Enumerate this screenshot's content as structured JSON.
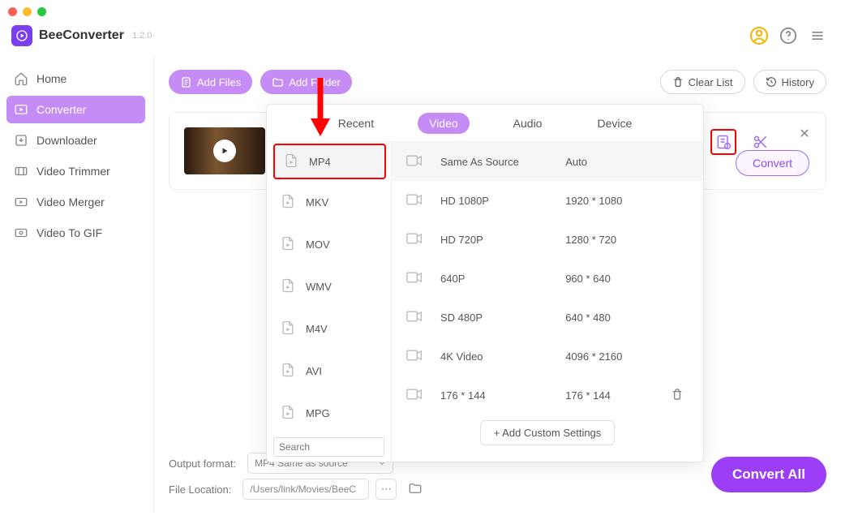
{
  "app": {
    "name": "BeeConverter",
    "version": "1.2.0"
  },
  "sidebar": {
    "items": [
      {
        "label": "Home"
      },
      {
        "label": "Converter"
      },
      {
        "label": "Downloader"
      },
      {
        "label": "Video Trimmer"
      },
      {
        "label": "Video Merger"
      },
      {
        "label": "Video To GIF"
      }
    ]
  },
  "toolbar": {
    "add_files": "Add Files",
    "add_folder": "Add Folder",
    "clear_list": "Clear List",
    "history": "History"
  },
  "card": {
    "convert_label": "Convert"
  },
  "popup": {
    "tabs": {
      "recent": "Recent",
      "video": "Video",
      "audio": "Audio",
      "device": "Device"
    },
    "formats": [
      "MP4",
      "MKV",
      "MOV",
      "WMV",
      "M4V",
      "AVI",
      "MPG"
    ],
    "search_placeholder": "Search",
    "resolutions": [
      {
        "name": "Same As Source",
        "res": "Auto"
      },
      {
        "name": "HD 1080P",
        "res": "1920 * 1080"
      },
      {
        "name": "HD 720P",
        "res": "1280 * 720"
      },
      {
        "name": "640P",
        "res": "960 * 640"
      },
      {
        "name": "SD 480P",
        "res": "640 * 480"
      },
      {
        "name": "4K Video",
        "res": "4096 * 2160"
      },
      {
        "name": "176 * 144",
        "res": "176 * 144",
        "deletable": true
      }
    ],
    "add_custom": "+ Add Custom Settings"
  },
  "footer": {
    "output_format_label": "Output format:",
    "output_format_value": "MP4 Same as source",
    "file_location_label": "File Location:",
    "file_location_value": "/Users/link/Movies/BeeC",
    "convert_all": "Convert All"
  }
}
